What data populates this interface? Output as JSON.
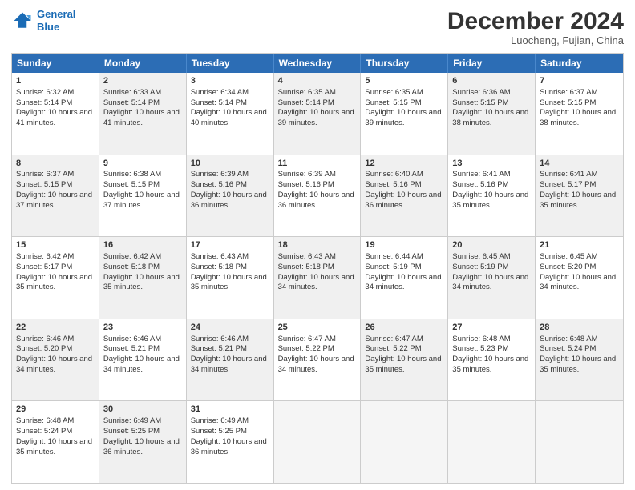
{
  "logo": {
    "line1": "General",
    "line2": "Blue"
  },
  "title": "December 2024",
  "location": "Luocheng, Fujian, China",
  "days_of_week": [
    "Sunday",
    "Monday",
    "Tuesday",
    "Wednesday",
    "Thursday",
    "Friday",
    "Saturday"
  ],
  "weeks": [
    [
      {
        "day": "1",
        "sunrise": "Sunrise: 6:32 AM",
        "sunset": "Sunset: 5:14 PM",
        "daylight": "Daylight: 10 hours and 41 minutes.",
        "shaded": false
      },
      {
        "day": "2",
        "sunrise": "Sunrise: 6:33 AM",
        "sunset": "Sunset: 5:14 PM",
        "daylight": "Daylight: 10 hours and 41 minutes.",
        "shaded": true
      },
      {
        "day": "3",
        "sunrise": "Sunrise: 6:34 AM",
        "sunset": "Sunset: 5:14 PM",
        "daylight": "Daylight: 10 hours and 40 minutes.",
        "shaded": false
      },
      {
        "day": "4",
        "sunrise": "Sunrise: 6:35 AM",
        "sunset": "Sunset: 5:14 PM",
        "daylight": "Daylight: 10 hours and 39 minutes.",
        "shaded": true
      },
      {
        "day": "5",
        "sunrise": "Sunrise: 6:35 AM",
        "sunset": "Sunset: 5:15 PM",
        "daylight": "Daylight: 10 hours and 39 minutes.",
        "shaded": false
      },
      {
        "day": "6",
        "sunrise": "Sunrise: 6:36 AM",
        "sunset": "Sunset: 5:15 PM",
        "daylight": "Daylight: 10 hours and 38 minutes.",
        "shaded": true
      },
      {
        "day": "7",
        "sunrise": "Sunrise: 6:37 AM",
        "sunset": "Sunset: 5:15 PM",
        "daylight": "Daylight: 10 hours and 38 minutes.",
        "shaded": false
      }
    ],
    [
      {
        "day": "8",
        "sunrise": "Sunrise: 6:37 AM",
        "sunset": "Sunset: 5:15 PM",
        "daylight": "Daylight: 10 hours and 37 minutes.",
        "shaded": true
      },
      {
        "day": "9",
        "sunrise": "Sunrise: 6:38 AM",
        "sunset": "Sunset: 5:15 PM",
        "daylight": "Daylight: 10 hours and 37 minutes.",
        "shaded": false
      },
      {
        "day": "10",
        "sunrise": "Sunrise: 6:39 AM",
        "sunset": "Sunset: 5:16 PM",
        "daylight": "Daylight: 10 hours and 36 minutes.",
        "shaded": true
      },
      {
        "day": "11",
        "sunrise": "Sunrise: 6:39 AM",
        "sunset": "Sunset: 5:16 PM",
        "daylight": "Daylight: 10 hours and 36 minutes.",
        "shaded": false
      },
      {
        "day": "12",
        "sunrise": "Sunrise: 6:40 AM",
        "sunset": "Sunset: 5:16 PM",
        "daylight": "Daylight: 10 hours and 36 minutes.",
        "shaded": true
      },
      {
        "day": "13",
        "sunrise": "Sunrise: 6:41 AM",
        "sunset": "Sunset: 5:16 PM",
        "daylight": "Daylight: 10 hours and 35 minutes.",
        "shaded": false
      },
      {
        "day": "14",
        "sunrise": "Sunrise: 6:41 AM",
        "sunset": "Sunset: 5:17 PM",
        "daylight": "Daylight: 10 hours and 35 minutes.",
        "shaded": true
      }
    ],
    [
      {
        "day": "15",
        "sunrise": "Sunrise: 6:42 AM",
        "sunset": "Sunset: 5:17 PM",
        "daylight": "Daylight: 10 hours and 35 minutes.",
        "shaded": false
      },
      {
        "day": "16",
        "sunrise": "Sunrise: 6:42 AM",
        "sunset": "Sunset: 5:18 PM",
        "daylight": "Daylight: 10 hours and 35 minutes.",
        "shaded": true
      },
      {
        "day": "17",
        "sunrise": "Sunrise: 6:43 AM",
        "sunset": "Sunset: 5:18 PM",
        "daylight": "Daylight: 10 hours and 35 minutes.",
        "shaded": false
      },
      {
        "day": "18",
        "sunrise": "Sunrise: 6:43 AM",
        "sunset": "Sunset: 5:18 PM",
        "daylight": "Daylight: 10 hours and 34 minutes.",
        "shaded": true
      },
      {
        "day": "19",
        "sunrise": "Sunrise: 6:44 AM",
        "sunset": "Sunset: 5:19 PM",
        "daylight": "Daylight: 10 hours and 34 minutes.",
        "shaded": false
      },
      {
        "day": "20",
        "sunrise": "Sunrise: 6:45 AM",
        "sunset": "Sunset: 5:19 PM",
        "daylight": "Daylight: 10 hours and 34 minutes.",
        "shaded": true
      },
      {
        "day": "21",
        "sunrise": "Sunrise: 6:45 AM",
        "sunset": "Sunset: 5:20 PM",
        "daylight": "Daylight: 10 hours and 34 minutes.",
        "shaded": false
      }
    ],
    [
      {
        "day": "22",
        "sunrise": "Sunrise: 6:46 AM",
        "sunset": "Sunset: 5:20 PM",
        "daylight": "Daylight: 10 hours and 34 minutes.",
        "shaded": true
      },
      {
        "day": "23",
        "sunrise": "Sunrise: 6:46 AM",
        "sunset": "Sunset: 5:21 PM",
        "daylight": "Daylight: 10 hours and 34 minutes.",
        "shaded": false
      },
      {
        "day": "24",
        "sunrise": "Sunrise: 6:46 AM",
        "sunset": "Sunset: 5:21 PM",
        "daylight": "Daylight: 10 hours and 34 minutes.",
        "shaded": true
      },
      {
        "day": "25",
        "sunrise": "Sunrise: 6:47 AM",
        "sunset": "Sunset: 5:22 PM",
        "daylight": "Daylight: 10 hours and 34 minutes.",
        "shaded": false
      },
      {
        "day": "26",
        "sunrise": "Sunrise: 6:47 AM",
        "sunset": "Sunset: 5:22 PM",
        "daylight": "Daylight: 10 hours and 35 minutes.",
        "shaded": true
      },
      {
        "day": "27",
        "sunrise": "Sunrise: 6:48 AM",
        "sunset": "Sunset: 5:23 PM",
        "daylight": "Daylight: 10 hours and 35 minutes.",
        "shaded": false
      },
      {
        "day": "28",
        "sunrise": "Sunrise: 6:48 AM",
        "sunset": "Sunset: 5:24 PM",
        "daylight": "Daylight: 10 hours and 35 minutes.",
        "shaded": true
      }
    ],
    [
      {
        "day": "29",
        "sunrise": "Sunrise: 6:48 AM",
        "sunset": "Sunset: 5:24 PM",
        "daylight": "Daylight: 10 hours and 35 minutes.",
        "shaded": false
      },
      {
        "day": "30",
        "sunrise": "Sunrise: 6:49 AM",
        "sunset": "Sunset: 5:25 PM",
        "daylight": "Daylight: 10 hours and 36 minutes.",
        "shaded": true
      },
      {
        "day": "31",
        "sunrise": "Sunrise: 6:49 AM",
        "sunset": "Sunset: 5:25 PM",
        "daylight": "Daylight: 10 hours and 36 minutes.",
        "shaded": false
      },
      {
        "day": "",
        "sunrise": "",
        "sunset": "",
        "daylight": "",
        "empty": true
      },
      {
        "day": "",
        "sunrise": "",
        "sunset": "",
        "daylight": "",
        "empty": true
      },
      {
        "day": "",
        "sunrise": "",
        "sunset": "",
        "daylight": "",
        "empty": true
      },
      {
        "day": "",
        "sunrise": "",
        "sunset": "",
        "daylight": "",
        "empty": true
      }
    ]
  ]
}
